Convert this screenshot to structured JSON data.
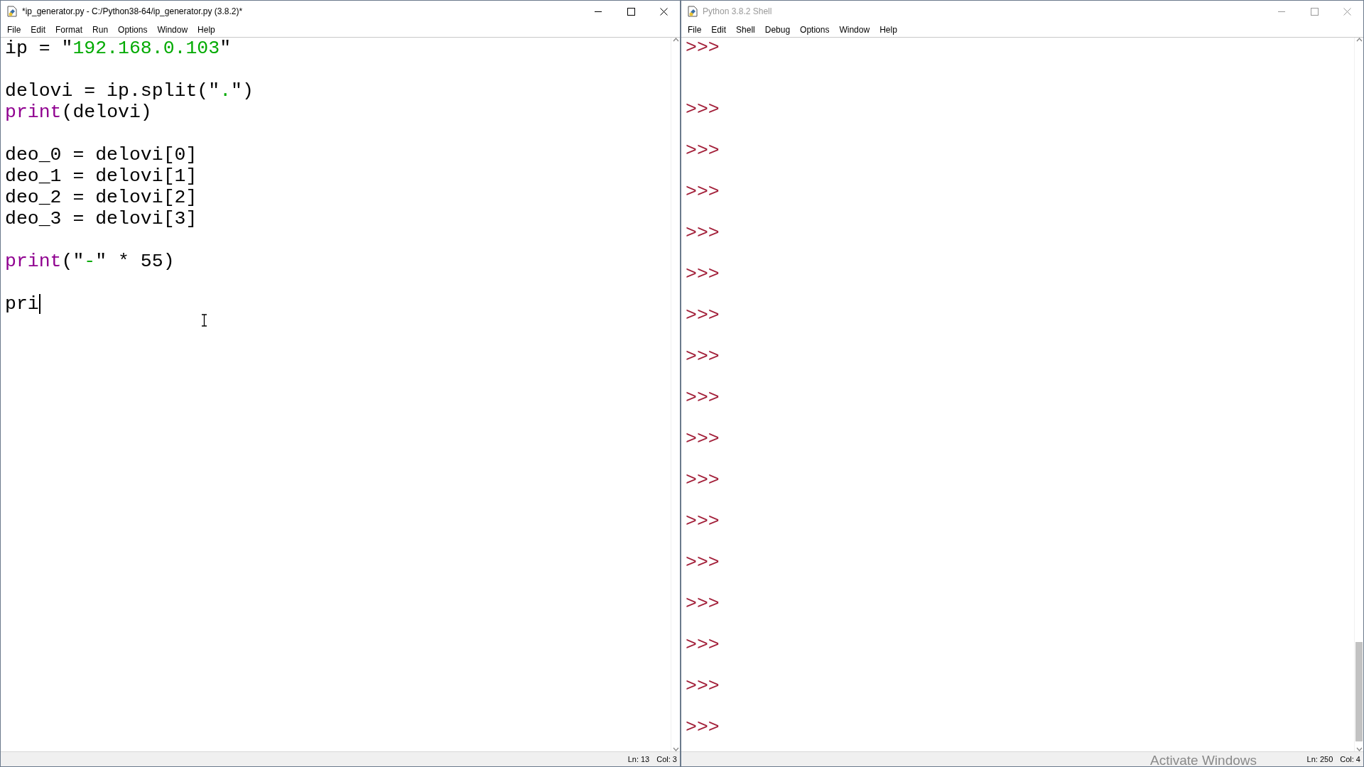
{
  "windows": [
    {
      "kind": "editor",
      "title": "*ip_generator.py - C:/Python38-64/ip_generator.py (3.8.2)*",
      "active": true,
      "menu": [
        "File",
        "Edit",
        "Format",
        "Run",
        "Options",
        "Window",
        "Help"
      ],
      "lines": [
        {
          "kind": "code",
          "tokens": [
            {
              "kind": "plain",
              "text": "ip = "
            },
            {
              "kind": "plain",
              "text": "\""
            },
            {
              "kind": "string",
              "text": "192.168.0.103"
            },
            {
              "kind": "plain",
              "text": "\""
            }
          ]
        },
        {
          "kind": "blank"
        },
        {
          "kind": "code",
          "tokens": [
            {
              "kind": "plain",
              "text": "delovi = ip.split("
            },
            {
              "kind": "plain",
              "text": "\""
            },
            {
              "kind": "string",
              "text": "."
            },
            {
              "kind": "plain",
              "text": "\")"
            }
          ]
        },
        {
          "kind": "code",
          "tokens": [
            {
              "kind": "builtin",
              "text": "print"
            },
            {
              "kind": "plain",
              "text": "(delovi)"
            }
          ]
        },
        {
          "kind": "blank"
        },
        {
          "kind": "code",
          "tokens": [
            {
              "kind": "plain",
              "text": "deo_0 = delovi[0]"
            }
          ]
        },
        {
          "kind": "code",
          "tokens": [
            {
              "kind": "plain",
              "text": "deo_1 = delovi[1]"
            }
          ]
        },
        {
          "kind": "code",
          "tokens": [
            {
              "kind": "plain",
              "text": "deo_2 = delovi[2]"
            }
          ]
        },
        {
          "kind": "code",
          "tokens": [
            {
              "kind": "plain",
              "text": "deo_3 = delovi[3]"
            }
          ]
        },
        {
          "kind": "blank"
        },
        {
          "kind": "code",
          "tokens": [
            {
              "kind": "builtin",
              "text": "print"
            },
            {
              "kind": "plain",
              "text": "(\""
            },
            {
              "kind": "string",
              "text": "-"
            },
            {
              "kind": "plain",
              "text": "\" * 55)"
            }
          ]
        },
        {
          "kind": "blank"
        },
        {
          "kind": "code",
          "caret": true,
          "tokens": [
            {
              "kind": "plain",
              "text": "pri"
            }
          ]
        }
      ],
      "status": [
        "Ln: 13",
        "Col: 3"
      ]
    },
    {
      "kind": "shell",
      "title": "Python 3.8.2 Shell",
      "active": false,
      "menu": [
        "File",
        "Edit",
        "Shell",
        "Debug",
        "Options",
        "Window",
        "Help"
      ],
      "lines": [
        {
          "kind": "prompt",
          "text": ">>>"
        },
        {
          "kind": "blank"
        },
        {
          "kind": "blank"
        },
        {
          "kind": "prompt",
          "text": ">>>"
        },
        {
          "kind": "blank"
        },
        {
          "kind": "prompt",
          "text": ">>>"
        },
        {
          "kind": "blank"
        },
        {
          "kind": "prompt",
          "text": ">>>"
        },
        {
          "kind": "blank"
        },
        {
          "kind": "prompt",
          "text": ">>>"
        },
        {
          "kind": "blank"
        },
        {
          "kind": "prompt",
          "text": ">>>"
        },
        {
          "kind": "blank"
        },
        {
          "kind": "prompt",
          "text": ">>>"
        },
        {
          "kind": "blank"
        },
        {
          "kind": "prompt",
          "text": ">>>"
        },
        {
          "kind": "blank"
        },
        {
          "kind": "prompt",
          "text": ">>>"
        },
        {
          "kind": "blank"
        },
        {
          "kind": "prompt",
          "text": ">>>"
        },
        {
          "kind": "blank"
        },
        {
          "kind": "prompt",
          "text": ">>>"
        },
        {
          "kind": "blank"
        },
        {
          "kind": "prompt",
          "text": ">>>"
        },
        {
          "kind": "blank"
        },
        {
          "kind": "prompt",
          "text": ">>>"
        },
        {
          "kind": "blank"
        },
        {
          "kind": "prompt",
          "text": ">>>"
        },
        {
          "kind": "blank"
        },
        {
          "kind": "prompt",
          "text": ">>>"
        },
        {
          "kind": "blank"
        },
        {
          "kind": "prompt",
          "text": ">>>"
        },
        {
          "kind": "blank"
        },
        {
          "kind": "prompt",
          "text": ">>>"
        }
      ],
      "watermark": "Activate Windows",
      "status": [
        "Ln: 250",
        "Col: 4"
      ]
    }
  ]
}
